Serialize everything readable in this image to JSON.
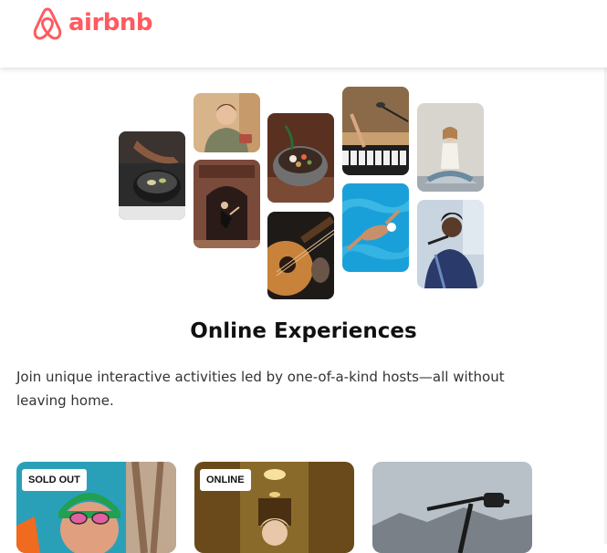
{
  "header": {
    "logo_text": "airbnb",
    "brand_color": "#ff5a5f"
  },
  "collage": {
    "tiles": [
      {
        "subject": "cooking-pan"
      },
      {
        "subject": "woman-host"
      },
      {
        "subject": "dancers-doorway"
      },
      {
        "subject": "food-bowl"
      },
      {
        "subject": "acoustic-guitar"
      },
      {
        "subject": "piano-singer"
      },
      {
        "subject": "swimmer"
      },
      {
        "subject": "yoga"
      },
      {
        "subject": "singer-mic"
      }
    ]
  },
  "main": {
    "title": "Online Experiences",
    "description": "Join unique interactive activities led by one-of-a-kind hosts—all without leaving home."
  },
  "cards": [
    {
      "badge": "SOLD OUT",
      "subject": "swimmer-athlete"
    },
    {
      "badge": "ONLINE",
      "subject": "woman-hallway"
    },
    {
      "badge": "",
      "subject": "bike-mountains"
    }
  ]
}
